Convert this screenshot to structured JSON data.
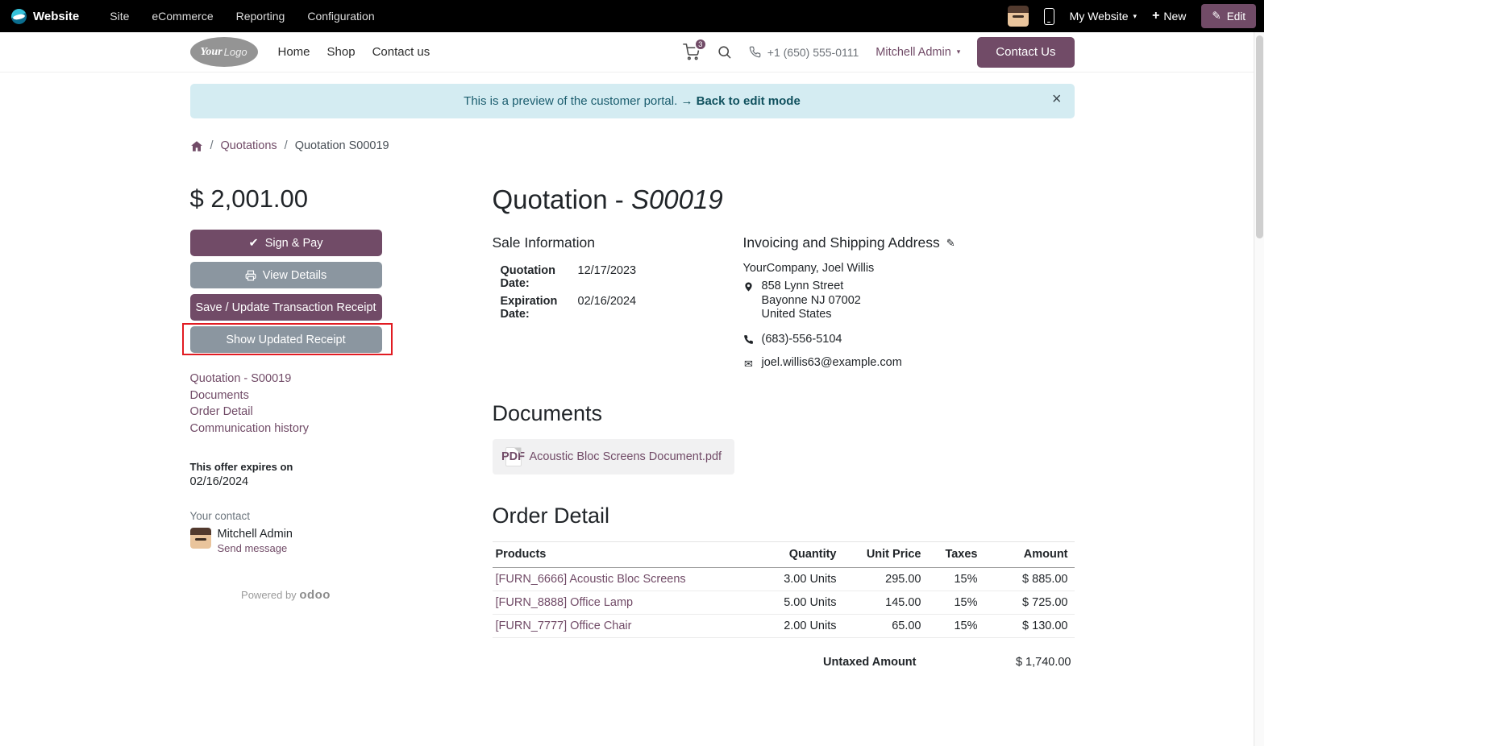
{
  "admin_bar": {
    "brand": "Website",
    "menus": [
      "Site",
      "eCommerce",
      "Reporting",
      "Configuration"
    ],
    "my_website": "My Website",
    "new_label": "New",
    "edit_label": "Edit"
  },
  "header": {
    "logo_your": "Your",
    "logo_logo": "Logo",
    "nav": [
      "Home",
      "Shop",
      "Contact us"
    ],
    "cart_count": "3",
    "phone": "+1 (650) 555-0111",
    "user": "Mitchell Admin",
    "contact_us": "Contact Us"
  },
  "alert": {
    "text": "This is a preview of the customer portal.",
    "link": "Back to edit mode"
  },
  "breadcrumb": {
    "quotations": "Quotations",
    "current": "Quotation S00019"
  },
  "sidebar": {
    "amount": "$ 2,001.00",
    "sign_pay": "Sign & Pay",
    "view_details": "View Details",
    "save_receipt": "Save / Update Transaction Receipt",
    "show_receipt": "Show Updated Receipt",
    "links": [
      "Quotation - S00019",
      "Documents",
      "Order Detail",
      "Communication history"
    ],
    "expires_label": "This offer expires on",
    "expires_date": "02/16/2024",
    "contact_label": "Your contact",
    "contact_name": "Mitchell Admin",
    "send_message": "Send message",
    "powered_by": "Powered by",
    "powered_brand": "odoo"
  },
  "main": {
    "title_prefix": "Quotation - ",
    "title_ref": "S00019",
    "sale_info": {
      "heading": "Sale Information",
      "rows": [
        {
          "label": "Quotation Date:",
          "value": "12/17/2023"
        },
        {
          "label": "Expiration Date:",
          "value": "02/16/2024"
        }
      ]
    },
    "address": {
      "heading": "Invoicing and Shipping Address",
      "company": "YourCompany, Joel Willis",
      "street": "858 Lynn Street",
      "city": "Bayonne NJ 07002",
      "country": "United States",
      "phone": "(683)-556-5104",
      "email": "joel.willis63@example.com"
    },
    "documents": {
      "heading": "Documents",
      "file": "Acoustic Bloc Screens Document.pdf",
      "pdf_label": "PDF"
    },
    "order": {
      "heading": "Order Detail",
      "headers": [
        "Products",
        "Quantity",
        "Unit Price",
        "Taxes",
        "Amount"
      ],
      "rows": [
        {
          "product": "[FURN_6666] Acoustic Bloc Screens",
          "qty": "3.00 Units",
          "price": "295.00",
          "tax": "15%",
          "amount": "$ 885.00"
        },
        {
          "product": "[FURN_8888] Office Lamp",
          "qty": "5.00 Units",
          "price": "145.00",
          "tax": "15%",
          "amount": "$ 725.00"
        },
        {
          "product": "[FURN_7777] Office Chair",
          "qty": "2.00 Units",
          "price": "65.00",
          "tax": "15%",
          "amount": "$ 130.00"
        }
      ],
      "untaxed_label": "Untaxed Amount",
      "untaxed_value": "$ 1,740.00"
    }
  },
  "icons": {
    "check": "✔",
    "pencil": "✎",
    "plus": "+",
    "caret": "▾",
    "close": "×",
    "arrow": "→",
    "envelope": "✉"
  },
  "colors": {
    "accent_purple": "#714B67",
    "secondary_gray": "#8b96a0",
    "alert_bg": "#d4ecf2",
    "annotation_red": "#e11b22",
    "admin_bar_bg": "#000000"
  }
}
